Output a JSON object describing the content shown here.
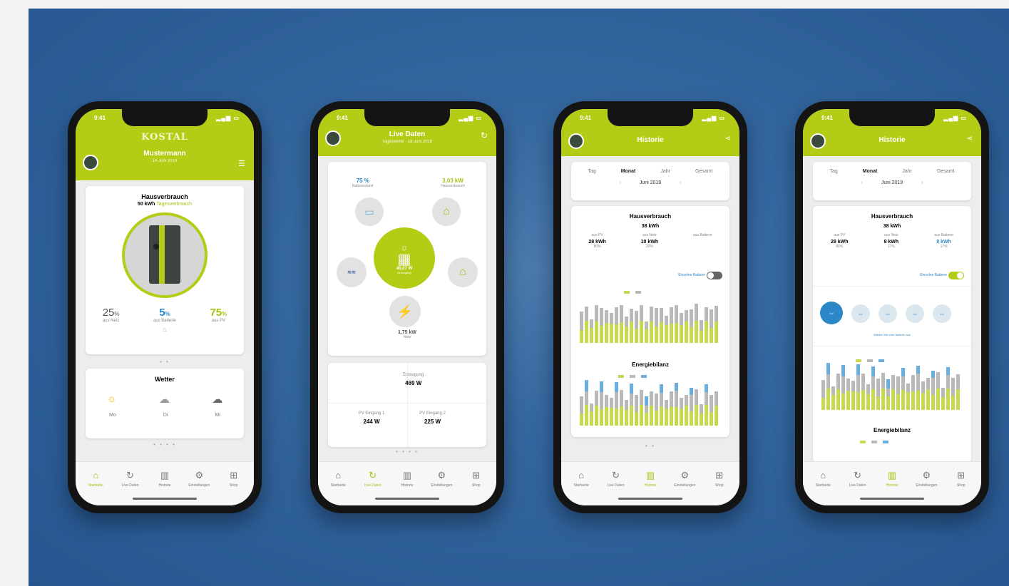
{
  "phone1": {
    "time": "9:41",
    "logo": "KOSTAL",
    "title": "Mustermann",
    "subtitle": "14 Juni 2019",
    "card_title": "Hausverbrauch",
    "card_value": "50 kWh",
    "card_value_suffix": "Tagesverbrauch",
    "stats": [
      {
        "value": "25",
        "unit": "%",
        "label": "aus Netz"
      },
      {
        "value": "5",
        "unit": "%",
        "label": "aus Batterie"
      },
      {
        "value": "75",
        "unit": "%",
        "label": "aus PV"
      }
    ],
    "weather_title": "Wetter",
    "weather_days": [
      "Mo",
      "Di",
      "Mi"
    ],
    "tabs": [
      "Startseite",
      "Live Daten",
      "Historie",
      "Einstellungen",
      "Shop"
    ]
  },
  "phone2": {
    "time": "9:41",
    "title": "Live Daten",
    "subtitle": "Tageswerte · 18 Juni 2019",
    "battery_pct": "75 %",
    "battery_label": "Batteriestand",
    "home_value": "3,03 kW",
    "home_label": "Hausverbrauch",
    "pv_value": "40,07 W",
    "pv_label": "Erzeugung",
    "grid_value": "1,75 kW",
    "grid_label": "Netz",
    "summary": {
      "top_label": "Erzeugung",
      "top_value": "469 W",
      "left_label": "PV Eingang 1",
      "left_value": "244 W",
      "right_label": "PV Eingang 2",
      "right_value": "225 W"
    },
    "tabs": [
      "Startseite",
      "Live Daten",
      "Historie",
      "Einstellungen",
      "Shop"
    ]
  },
  "phone3": {
    "time": "9:41",
    "title": "Historie",
    "periods": [
      "Tag",
      "Monat",
      "Jahr",
      "Gesamt"
    ],
    "active_period": "Monat",
    "month": "Juni 2019",
    "card_title": "Hausverbrauch",
    "card_total": "38 kWh",
    "cols": [
      {
        "label": "aus PV",
        "value": "28 kWh",
        "pct": "80%"
      },
      {
        "label": "aus Netz",
        "value": "10 kWh",
        "pct": "20%"
      },
      {
        "label": "aus Batterie",
        "value": "",
        "pct": ""
      }
    ],
    "toggle_label": "Einzelne Batterie",
    "energy_title": "Energiebilanz",
    "tabs": [
      "Startseite",
      "Live Daten",
      "Historie",
      "Einstellungen",
      "Shop"
    ]
  },
  "phone4": {
    "time": "9:41",
    "title": "Historie",
    "periods": [
      "Tag",
      "Monat",
      "Jahr",
      "Gesamt"
    ],
    "active_period": "Monat",
    "month": "Juni 2019",
    "card_title": "Hausverbrauch",
    "card_total": "38 kWh",
    "cols": [
      {
        "label": "aus PV",
        "value": "28 kWh",
        "pct": "80%"
      },
      {
        "label": "aus Netz",
        "value": "8 kWh",
        "pct": "17%"
      },
      {
        "label": "aus Batterie",
        "value": "8 kWh",
        "pct": "17%"
      }
    ],
    "toggle_label": "Einzelne Batterie",
    "info_text": "Wählen Sie eine Batterie aus",
    "energy_title": "Energiebilanz",
    "tabs": [
      "Startseite",
      "Live Daten",
      "Historie",
      "Einstellungen",
      "Shop"
    ]
  },
  "colors": {
    "brand_green": "#b5cc16",
    "background_blue": "#2e5f97",
    "accent_blue": "#2b87c8"
  }
}
